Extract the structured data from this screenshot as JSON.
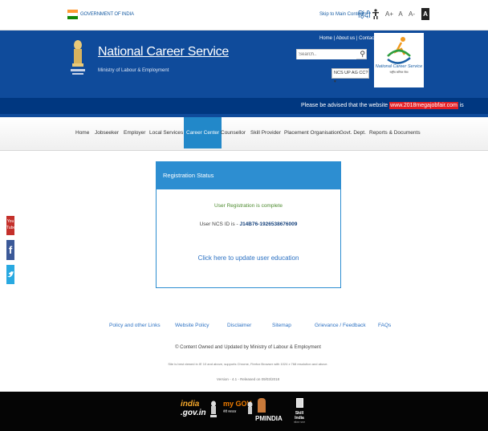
{
  "gov_bar": {
    "label": "GOVERNMENT OF INDIA",
    "skip_link": "Skip to Main Content",
    "hindi": "हिंदी",
    "font_large": "A+",
    "font_normal": "A",
    "font_small": "A-",
    "contrast": "A"
  },
  "header": {
    "title": "National Career Service",
    "subtitle": "Ministry of Labour & Employment",
    "top_links": "Home | About us | Contact Us",
    "search_placeholder": "Search..",
    "language_select": "NCS UP AG CC? ▾",
    "logo_text": "National Career Service",
    "logo_subtext": "राष्ट्रीय करियर सेवा",
    "notice_prefix": "Please be advised that the website",
    "notice_link": "www.2018megajobfair.com",
    "notice_suffix": "is"
  },
  "nav": {
    "items": [
      {
        "label": "Home"
      },
      {
        "label": "Jobseeker"
      },
      {
        "label": "Employer"
      },
      {
        "label": "Local Services"
      },
      {
        "label": "Career Center"
      },
      {
        "label": "Counsellor"
      },
      {
        "label": "Skill Provider"
      },
      {
        "label": "Placement Organisation"
      },
      {
        "label": "Govt. Dept."
      },
      {
        "label": "Reports & Documents"
      }
    ],
    "active": "Career Center"
  },
  "social": {
    "youtube": "You Tube",
    "facebook": "f"
  },
  "panel": {
    "title": "Registration Status",
    "status": "User Registration is complete",
    "ncs_id_label": "User NCS ID is -",
    "ncs_id_value": "J14B76-1926538676009",
    "update_link": "Click here to update user education"
  },
  "footer": {
    "links": [
      "Policy and other Links",
      "Website Policy",
      "Disclaimer",
      "Sitemap",
      "Grievance / Feedback",
      "FAQs"
    ],
    "copyright": "© Content Owned and Updated by Ministry of Labour & Employment",
    "bestview": "Site is best viewed in IE 10 and above, supports Chrome, Firefox Browser with 1024 x 768 resolution and above.",
    "version": "Version - 4.1 - Released on 09/03/2018"
  },
  "bottom_logos": {
    "india_gov_1": "india",
    "india_gov_2": ".gov.in",
    "mygov": "my GOV",
    "mygov_sub": "मेरी सरकार",
    "pmindia": "PMINDIA",
    "skill_india": "Skill India",
    "skill_india_sub": "कौशल भारत"
  }
}
